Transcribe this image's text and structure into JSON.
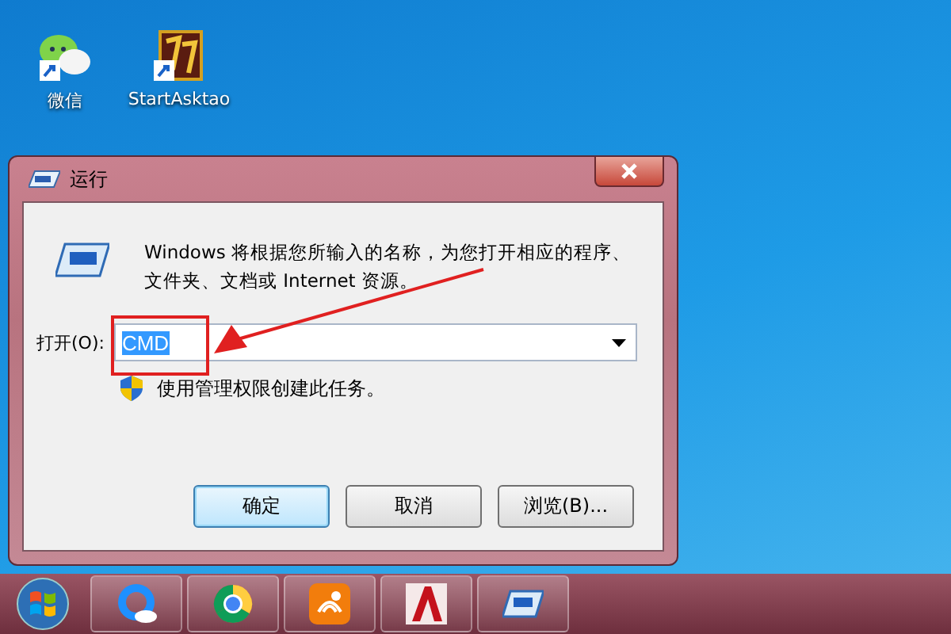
{
  "desktop_icons": [
    {
      "label": "微信",
      "kind": "chat"
    },
    {
      "label": "StartAsktao",
      "kind": "game"
    }
  ],
  "dialog": {
    "title": "运行",
    "description": "Windows 将根据您所输入的名称，为您打开相应的程序、文件夹、文档或 Internet 资源。",
    "open_label": "打开(O):",
    "command": "CMD",
    "admin_note": "使用管理权限创建此任务。",
    "buttons": [
      {
        "label": "确定",
        "default": true
      },
      {
        "label": "取消",
        "default": false
      },
      {
        "label": "浏览(B)...",
        "default": false
      }
    ]
  }
}
